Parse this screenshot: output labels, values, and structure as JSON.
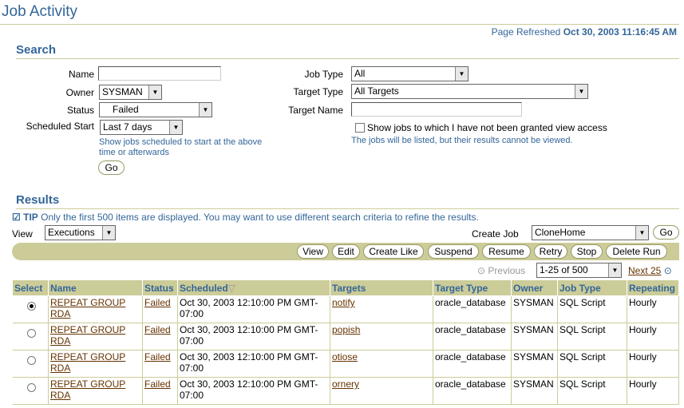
{
  "page": {
    "title": "Job Activity",
    "refreshed_label": "Page Refreshed",
    "refreshed_time": "Oct 30, 2003 11:16:45 AM"
  },
  "search": {
    "heading": "Search",
    "name_label": "Name",
    "name_value": "",
    "owner_label": "Owner",
    "owner_value": "SYSMAN",
    "status_label": "Status",
    "status_value": "Failed",
    "scheduled_start_label": "Scheduled Start",
    "scheduled_start_value": "Last 7 days",
    "scheduled_hint": "Show jobs scheduled to start at the above time or afterwards",
    "go_label": "Go",
    "job_type_label": "Job Type",
    "job_type_value": "All",
    "target_type_label": "Target Type",
    "target_type_value": "All Targets",
    "target_name_label": "Target Name",
    "target_name_value": "",
    "show_jobs_label": "Show jobs to which I have not been granted view access",
    "show_jobs_checked": false,
    "show_jobs_hint": "The jobs will be listed, but their results cannot be viewed."
  },
  "results": {
    "heading": "Results",
    "tip_label": "TIP",
    "tip_text": "Only the first 500 items are displayed. You may want to use different search criteria to refine the results.",
    "view_label": "View",
    "view_value": "Executions",
    "create_job_label": "Create Job",
    "create_job_value": "CloneHome",
    "create_go_label": "Go",
    "actions": [
      "View",
      "Edit",
      "Create Like",
      "Suspend",
      "Resume",
      "Retry",
      "Stop",
      "Delete Run"
    ],
    "previous_label": "Previous",
    "range_value": "1-25 of 500",
    "next_label": "Next 25",
    "columns": [
      "Select",
      "Name",
      "Status",
      "Scheduled",
      "Targets",
      "Target Type",
      "Owner",
      "Job Type",
      "Repeating"
    ],
    "sort_indicator": "▽",
    "rows": [
      {
        "selected": true,
        "name": "REPEAT GROUP RDA",
        "status": "Failed",
        "scheduled": "Oct 30, 2003 12:10:00 PM GMT-07:00",
        "target": "notify",
        "target_type": "oracle_database",
        "owner": "SYSMAN",
        "job_type": "SQL Script",
        "repeating": "Hourly"
      },
      {
        "selected": false,
        "name": "REPEAT GROUP RDA",
        "status": "Failed",
        "scheduled": "Oct 30, 2003 12:10:00 PM GMT-07:00",
        "target": "popish",
        "target_type": "oracle_database",
        "owner": "SYSMAN",
        "job_type": "SQL Script",
        "repeating": "Hourly"
      },
      {
        "selected": false,
        "name": "REPEAT GROUP RDA",
        "status": "Failed",
        "scheduled": "Oct 30, 2003 12:10:00 PM GMT-07:00",
        "target": "otiose",
        "target_type": "oracle_database",
        "owner": "SYSMAN",
        "job_type": "SQL Script",
        "repeating": "Hourly"
      },
      {
        "selected": false,
        "name": "REPEAT GROUP RDA",
        "status": "Failed",
        "scheduled": "Oct 30, 2003 12:10:00 PM GMT-07:00",
        "target": "ornery",
        "target_type": "oracle_database",
        "owner": "SYSMAN",
        "job_type": "SQL Script",
        "repeating": "Hourly"
      }
    ]
  },
  "colors": {
    "accent": "#336699",
    "band": "#cccc99",
    "link": "#663300"
  }
}
